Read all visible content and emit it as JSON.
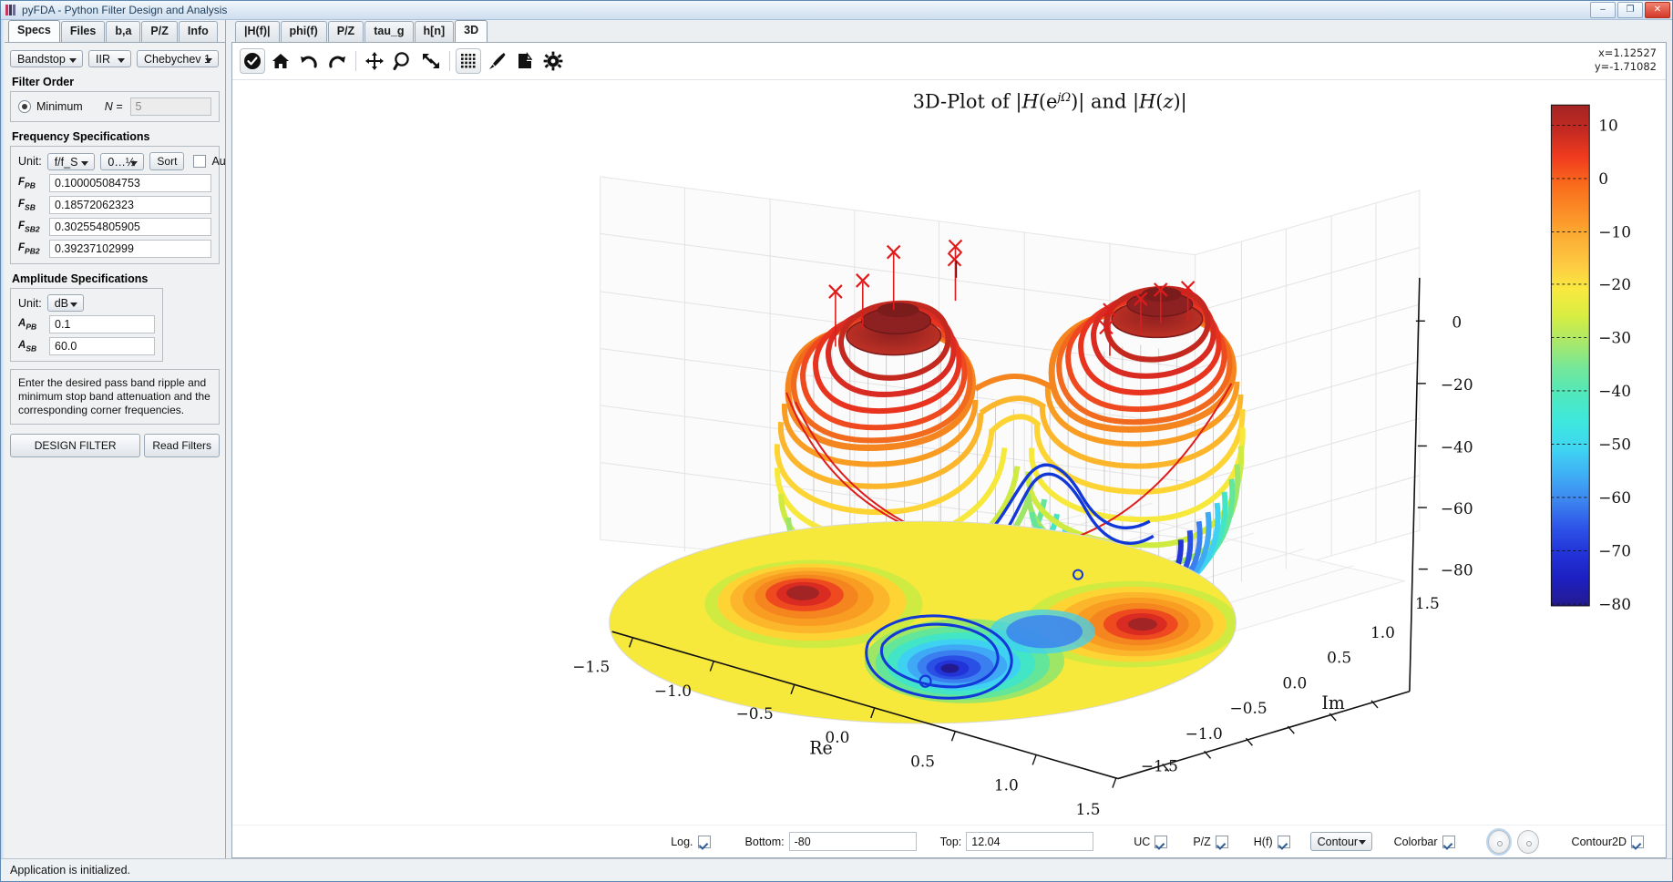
{
  "window": {
    "title": "pyFDA - Python Filter Design and Analysis",
    "minimize": "–",
    "maximize": "❐",
    "close": "✕"
  },
  "left_tabs": [
    {
      "label": "Specs",
      "active": true
    },
    {
      "label": "Files",
      "active": false
    },
    {
      "label": "b,a",
      "active": false
    },
    {
      "label": "P/Z",
      "active": false
    },
    {
      "label": "Info",
      "active": false
    }
  ],
  "filter_selectors": {
    "response_type": "Bandstop",
    "filter_class": "IIR",
    "design_method": "Chebychev 1"
  },
  "filter_order": {
    "title": "Filter Order",
    "mode_label": "Minimum",
    "n_label": "N =",
    "n_value": "5"
  },
  "frequency_specs": {
    "title": "Frequency Specifications",
    "unit_label": "Unit:",
    "unit_value": "f/f_S",
    "range_value": "0…½",
    "sort_label": "Sort",
    "auto_label": "Auto",
    "auto_checked": false,
    "rows": [
      {
        "name": "F",
        "sub": "PB",
        "value": "0.100005084753"
      },
      {
        "name": "F",
        "sub": "SB",
        "value": "0.18572062323"
      },
      {
        "name": "F",
        "sub": "SB2",
        "value": "0.302554805905"
      },
      {
        "name": "F",
        "sub": "PB2",
        "value": "0.39237102999"
      }
    ]
  },
  "amplitude_specs": {
    "title": "Amplitude Specifications",
    "unit_label": "Unit:",
    "unit_value": "dB",
    "rows": [
      {
        "name": "A",
        "sub": "PB",
        "value": "0.1"
      },
      {
        "name": "A",
        "sub": "SB",
        "value": "60.0"
      }
    ]
  },
  "info_text": "Enter the desired pass band ripple and minimum stop band attenuation and the corresponding corner frequencies.",
  "actions": {
    "design_filter": "DESIGN FILTER",
    "read_filters": "Read Filters"
  },
  "plot_tabs": [
    {
      "label": "|H(f)|",
      "active": false
    },
    {
      "label": "phi(f)",
      "active": false
    },
    {
      "label": "P/Z",
      "active": false
    },
    {
      "label": "tau_g",
      "active": false
    },
    {
      "label": "h[n]",
      "active": false
    },
    {
      "label": "3D",
      "active": true
    }
  ],
  "mpl_toolbar": [
    {
      "name": "enable-update-icon",
      "selected": true
    },
    {
      "name": "home-icon",
      "selected": false
    },
    {
      "name": "back-arrow-icon",
      "selected": false
    },
    {
      "name": "forward-arrow-icon",
      "selected": false
    },
    {
      "name": "pan-move-icon",
      "selected": false
    },
    {
      "name": "zoom-magnifier-icon",
      "selected": false
    },
    {
      "name": "full-view-icon",
      "selected": false
    },
    {
      "name": "grid-icon",
      "selected": true
    },
    {
      "name": "paintbrush-icon",
      "selected": false
    },
    {
      "name": "save-figure-icon",
      "selected": false
    },
    {
      "name": "settings-gear-icon",
      "selected": false
    }
  ],
  "cursor_readout": {
    "x": "x=1.12527",
    "y": "y=-1.71082"
  },
  "bottom_controls": {
    "log_label": "Log.",
    "log_checked": true,
    "bottom_label": "Bottom:",
    "bottom_value": "-80",
    "top_label": "Top:",
    "top_value": "12.04",
    "uc_label": "UC",
    "uc_checked": true,
    "pz_label": "P/Z",
    "pz_checked": true,
    "hf_label": "H(f)",
    "hf_checked": true,
    "plot_style": "Contour",
    "colorbar_label": "Colorbar",
    "colorbar_checked": true,
    "contour2d_label": "Contour2D",
    "contour2d_checked": true
  },
  "statusbar": {
    "message": "Application is initialized."
  },
  "chart_data": {
    "type": "surface3d",
    "title": "3D-Plot of |H(e^{jΩ})| and |H(z)|",
    "xlabel": "Re",
    "ylabel": "Im",
    "zlabel": "",
    "x_ticks": [
      "-1.5",
      "-1.0",
      "-0.5",
      "0.0",
      "0.5",
      "1.0",
      "1.5"
    ],
    "y_ticks": [
      "1.5",
      "1.0",
      "0.5",
      "0.0",
      "-0.5",
      "-1.0",
      "-1.5"
    ],
    "z_ticks": [
      "0",
      "-20",
      "-40",
      "-60",
      "-80"
    ],
    "zlim": [
      -80,
      12.04
    ],
    "colorbar": {
      "ticks": [
        "10",
        "0",
        "-10",
        "-20",
        "-30",
        "-40",
        "-50",
        "-60",
        "-70",
        "-80"
      ],
      "vmin": -80,
      "vmax": 12.04,
      "colors": [
        "#a32424",
        "#c62a22",
        "#f03c1e",
        "#fa6a1c",
        "#fb8c26",
        "#fcad33",
        "#fdc842",
        "#f9e940",
        "#d8ed42",
        "#a8e86a",
        "#74e79a",
        "#4fe8bd",
        "#3ee8dd",
        "#3fd6f2",
        "#3fb0f5",
        "#3d86f0",
        "#2e55e8",
        "#2233d8",
        "#1d1fc0",
        "#241a8f"
      ]
    },
    "grid": true,
    "legend": "none"
  }
}
